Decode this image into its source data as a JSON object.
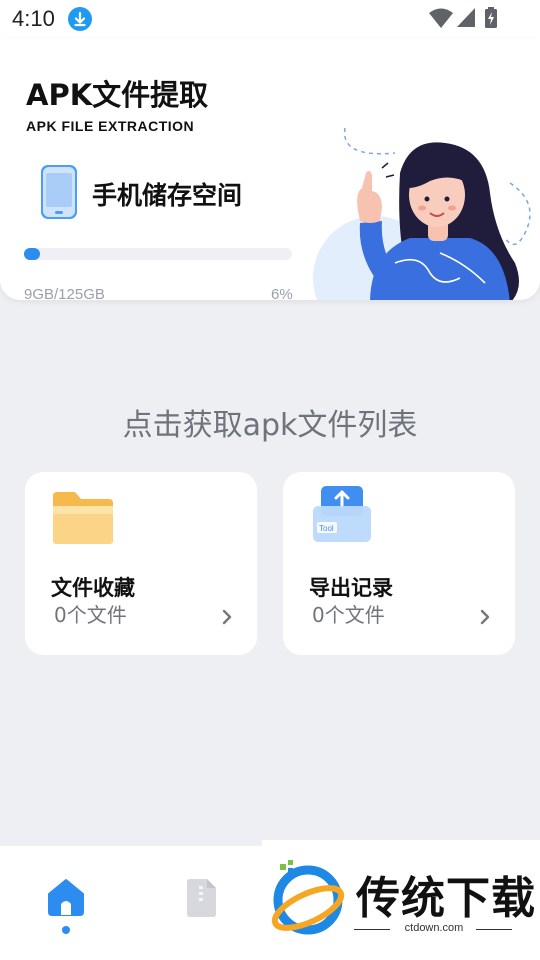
{
  "status_bar": {
    "time": "4:10"
  },
  "header": {
    "title": "APK文件提取",
    "subtitle": "APK FILE EXTRACTION",
    "storage_label": "手机储存空间",
    "storage_used": "9GB/125GB",
    "storage_percent": "6%",
    "storage_fraction": 0.06
  },
  "main": {
    "prompt": "点击获取apk文件列表",
    "tiles": [
      {
        "title": "文件收藏",
        "count": "0个文件",
        "icon": "folder-icon"
      },
      {
        "title": "导出记录",
        "count": "0个文件",
        "icon": "export-box-icon",
        "icon_tag": "Tool"
      }
    ]
  },
  "bottom_nav": {
    "items": [
      {
        "icon": "home-icon",
        "active": true
      },
      {
        "icon": "file-archive-icon",
        "active": false
      }
    ]
  },
  "watermark": {
    "text": "传统下载",
    "url": "ctdown.com"
  },
  "colors": {
    "accent": "#2c8cf0",
    "background": "#eeeff3",
    "card": "#ffffff"
  }
}
